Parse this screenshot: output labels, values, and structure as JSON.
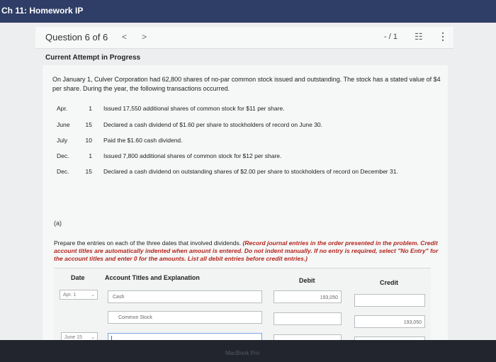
{
  "window": {
    "title": "Ch 11: Homework IP"
  },
  "question_header": {
    "label": "Question 6 of 6",
    "prev": "<",
    "next": ">",
    "score": "- / 1",
    "list_glyph": "☷",
    "more_glyph": "⋮"
  },
  "attempt_status": "Current Attempt in Progress",
  "problem_text": "On January 1, Culver Corporation had 62,800 shares of no-par common stock issued and outstanding. The stock has a stated value of $4 per share. During the year, the following transactions occurred.",
  "transactions": [
    {
      "month": "Apr.",
      "day": "1",
      "text": "Issued 17,550 additional shares of common stock for $11 per share."
    },
    {
      "month": "June",
      "day": "15",
      "text": "Declared a cash dividend of $1.60 per share to stockholders of record on June 30."
    },
    {
      "month": "July",
      "day": "10",
      "text": "Paid the $1.60 cash dividend."
    },
    {
      "month": "Dec.",
      "day": "1",
      "text": "Issued 7,800 additional shares of common stock for $12 per share."
    },
    {
      "month": "Dec.",
      "day": "15",
      "text": "Declared a cash dividend on outstanding shares of $2.00 per share to stockholders of record on December 31."
    }
  ],
  "part_label": "(a)",
  "instructions": {
    "normal": "Prepare the entries on each of the three dates that involved dividends. ",
    "required": "(Record journal entries in the order presented in the problem. Credit account titles are automatically indented when amount is entered. Do not indent manually. If no entry is required, select \"No Entry\" for the account titles and enter 0 for the amounts. List all debit entries before credit entries.)"
  },
  "journal": {
    "headers": {
      "date": "Date",
      "account": "Account Titles and Explanation",
      "debit": "Debit",
      "credit": "Credit"
    },
    "rows": [
      {
        "date": "Apr. 1",
        "account": "Cash",
        "debit": "193,050",
        "credit": ""
      },
      {
        "date": "",
        "account": "Common Stock",
        "debit": "",
        "credit": "193,050"
      },
      {
        "date": "June 15",
        "account": "",
        "debit": "",
        "credit": ""
      }
    ]
  },
  "chevron_glyph": "⌄",
  "footer": {
    "device": "MacBook Pro"
  }
}
